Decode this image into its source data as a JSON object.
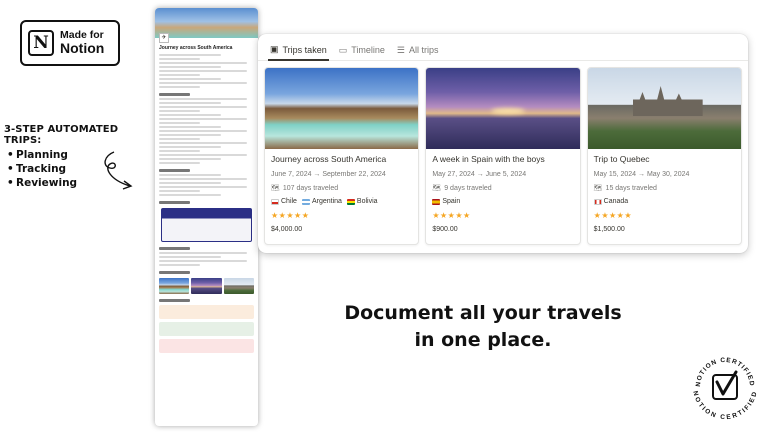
{
  "badge": {
    "line1": "Made for",
    "line2": "Notion",
    "logo_letter": "N"
  },
  "promo": {
    "title": "3-STEP AUTOMATED TRIPS:",
    "steps": [
      "Planning",
      "Tracking",
      "Reviewing"
    ]
  },
  "page_preview": {
    "title": "Journey across South America"
  },
  "gallery": {
    "tabs": [
      {
        "label": "Trips taken",
        "icon": "gallery-icon",
        "active": true
      },
      {
        "label": "Timeline",
        "icon": "timeline-icon",
        "active": false
      },
      {
        "label": "All trips",
        "icon": "list-icon",
        "active": false
      }
    ],
    "cards": [
      {
        "title": "Journey across South America",
        "dates": "June 7, 2024 → September 22, 2024",
        "days": "107 days traveled",
        "countries": [
          "Chile",
          "Argentina",
          "Bolivia"
        ],
        "rating": 5,
        "stars": "★★★★★",
        "price": "$4,000.00"
      },
      {
        "title": "A week in Spain with the boys",
        "dates": "May 27, 2024 → June 5, 2024",
        "days": "9 days traveled",
        "countries": [
          "Spain"
        ],
        "rating": 5,
        "stars": "★★★★★",
        "price": "$900.00"
      },
      {
        "title": "Trip to Quebec",
        "dates": "May 15, 2024 → May 30, 2024",
        "days": "15 days traveled",
        "countries": [
          "Canada"
        ],
        "rating": 5,
        "stars": "★★★★★",
        "price": "$1,500.00"
      }
    ]
  },
  "headline": {
    "line1": "Document all your travels",
    "line2": "in one place."
  },
  "stamp": {
    "top": "NOTION CERTIFIED",
    "bottom": "NOTION CERTIFIED"
  },
  "colors": {
    "star": "#f5a623",
    "text": "#37352f",
    "muted": "#787774"
  }
}
